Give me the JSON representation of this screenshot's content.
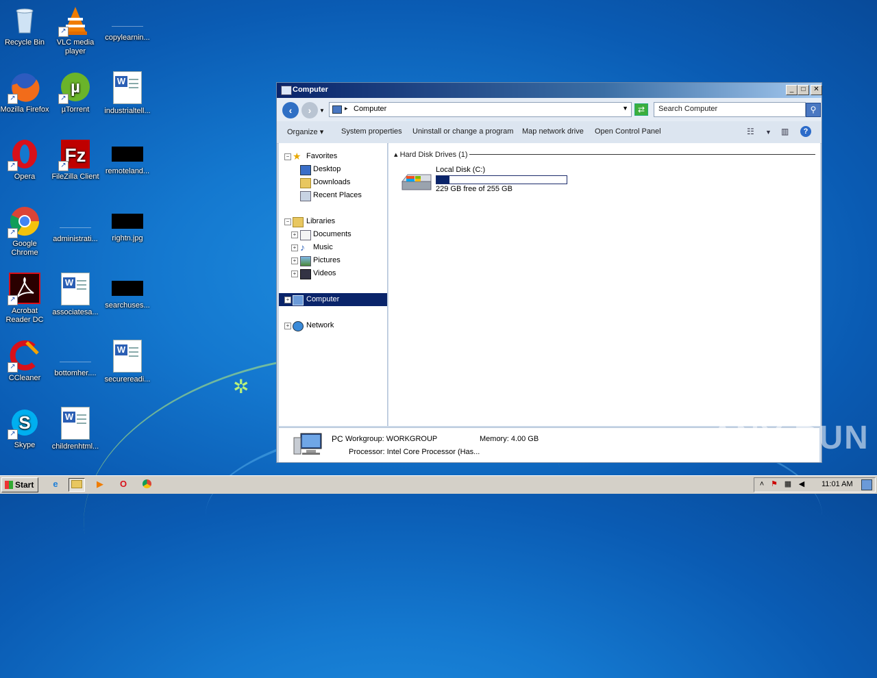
{
  "desktop": {
    "icons": [
      {
        "label": "Recycle Bin",
        "icon": "recycle-bin-icon"
      },
      {
        "label": "VLC media player",
        "icon": "vlc-icon"
      },
      {
        "label": "copylearnin...",
        "icon": "file-icon"
      },
      {
        "label": "Mozilla Firefox",
        "icon": "firefox-icon"
      },
      {
        "label": "µTorrent",
        "icon": "utorrent-icon"
      },
      {
        "label": "industrialtell...",
        "icon": "word-doc-icon"
      },
      {
        "label": "Opera",
        "icon": "opera-icon"
      },
      {
        "label": "FileZilla Client",
        "icon": "filezilla-icon"
      },
      {
        "label": "remoteland...",
        "icon": "image-file-icon"
      },
      {
        "label": "Google Chrome",
        "icon": "chrome-icon"
      },
      {
        "label": "administrati...",
        "icon": "file-icon"
      },
      {
        "label": "rightn.jpg",
        "icon": "image-file-icon"
      },
      {
        "label": "Acrobat Reader DC",
        "icon": "acrobat-icon"
      },
      {
        "label": "associatesa...",
        "icon": "word-doc-icon"
      },
      {
        "label": "searchuses...",
        "icon": "image-file-icon"
      },
      {
        "label": "CCleaner",
        "icon": "ccleaner-icon"
      },
      {
        "label": "bottomher....",
        "icon": "file-icon"
      },
      {
        "label": "securereadi...",
        "icon": "word-doc-icon"
      },
      {
        "label": "Skype",
        "icon": "skype-icon"
      },
      {
        "label": "childrenhtml...",
        "icon": "word-doc-icon"
      }
    ]
  },
  "window": {
    "title": "Computer",
    "address": "Computer",
    "search_placeholder": "Search Computer",
    "commands": {
      "organize": "Organize",
      "system_properties": "System properties",
      "uninstall": "Uninstall or change a program",
      "map_drive": "Map network drive",
      "control_panel": "Open Control Panel"
    },
    "nav": {
      "favorites": "Favorites",
      "desktop": "Desktop",
      "downloads": "Downloads",
      "recent": "Recent Places",
      "libraries": "Libraries",
      "documents": "Documents",
      "music": "Music",
      "pictures": "Pictures",
      "videos": "Videos",
      "computer": "Computer",
      "network": "Network"
    },
    "content": {
      "group_header": "Hard Disk Drives (1)",
      "drive_name": "Local Disk (C:)",
      "drive_free_text": "229 GB free of 255 GB",
      "drive_used_fraction": 0.102
    },
    "details": {
      "pc_name": "PC",
      "workgroup": "Workgroup: WORKGROUP",
      "memory": "Memory: 4.00 GB",
      "processor": "Processor: Intel Core Processor (Has..."
    }
  },
  "watermark": "ANY RUN",
  "taskbar": {
    "start_label": "Start",
    "clock": "11:01 AM"
  }
}
